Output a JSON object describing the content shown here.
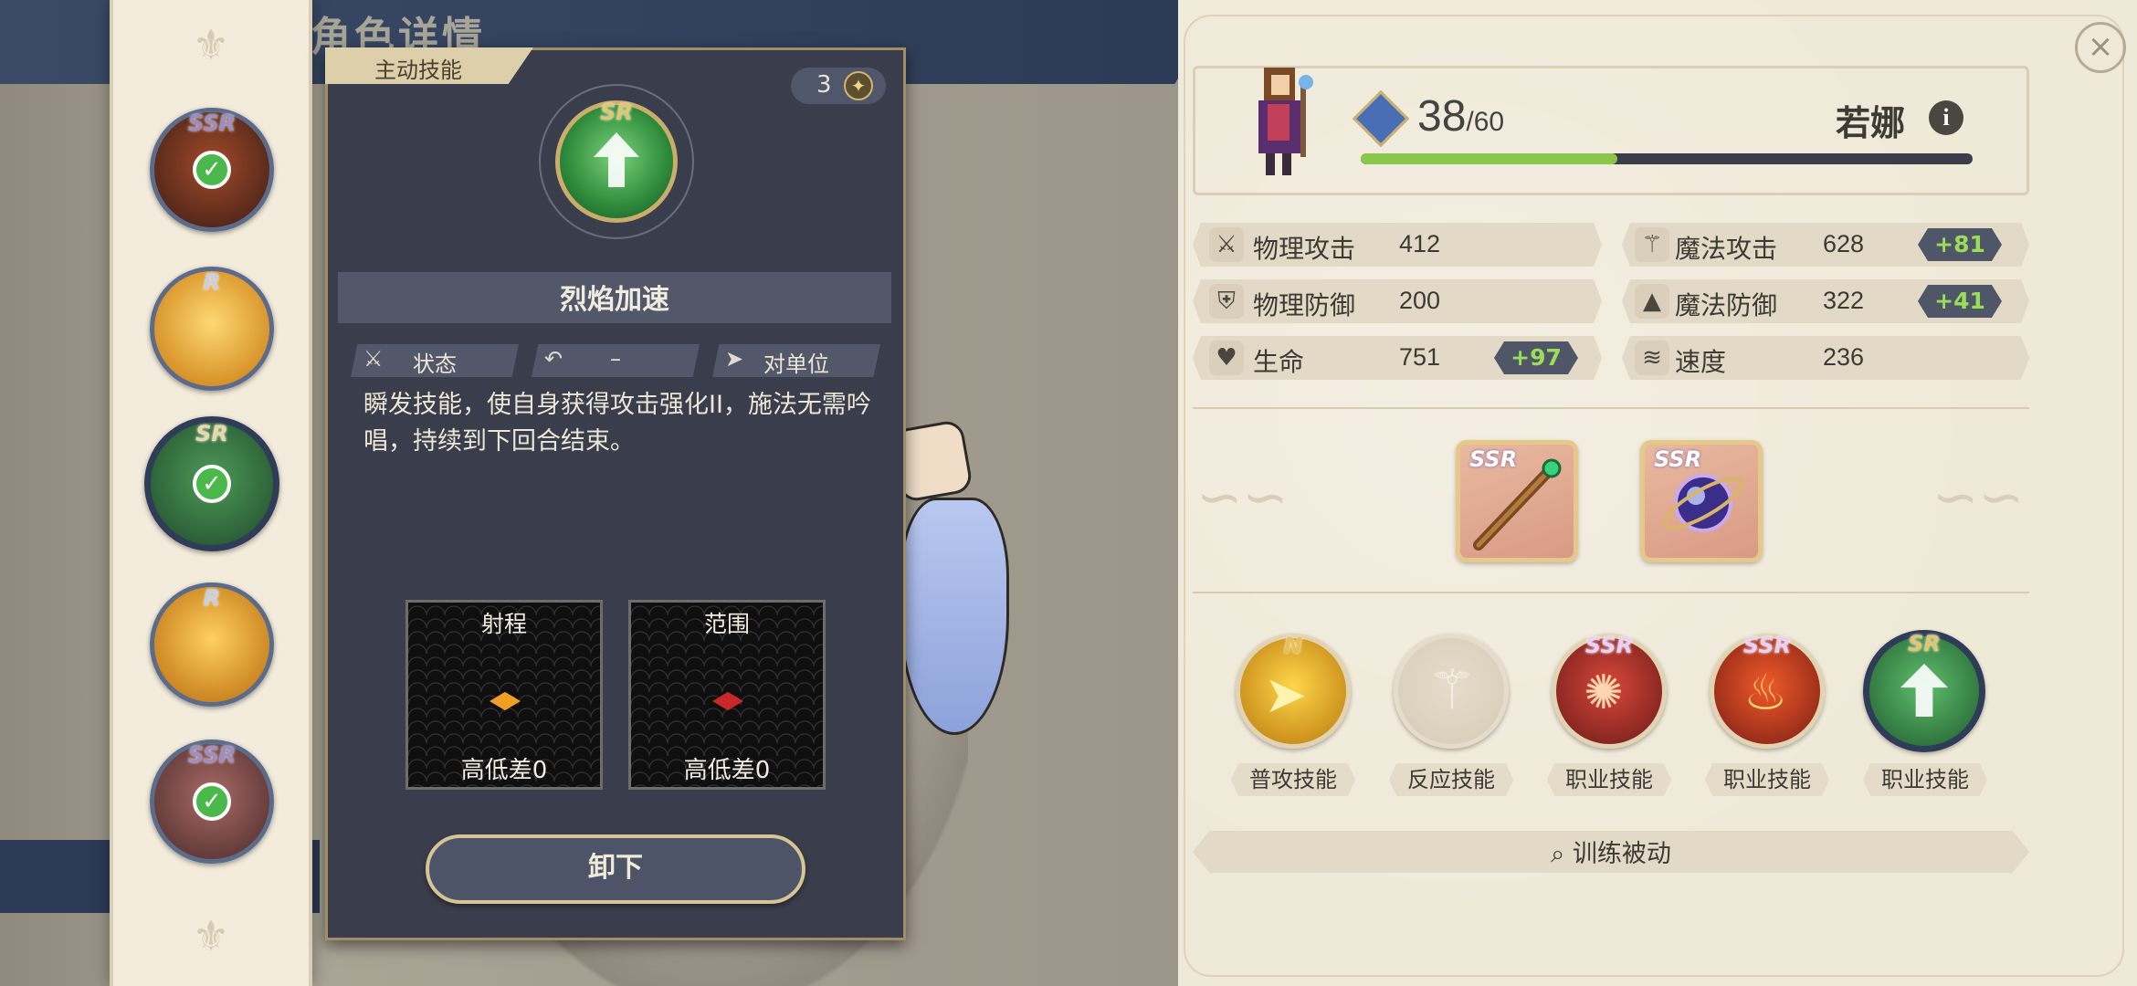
{
  "background": {
    "title": "角色详情"
  },
  "sidebar": {
    "skills": [
      {
        "rarity": "SSR",
        "equipped": true,
        "colors": [
          "#a24a2a",
          "#3a1c14"
        ]
      },
      {
        "rarity": "R",
        "equipped": false,
        "colors": [
          "#ffd873",
          "#c7780c"
        ]
      },
      {
        "rarity": "SR",
        "equipped": true,
        "selected": true,
        "colors": [
          "#4e9a58",
          "#1f4a2a"
        ]
      },
      {
        "rarity": "R",
        "equipped": false,
        "colors": [
          "#ffd060",
          "#b86a0a"
        ]
      },
      {
        "rarity": "SSR",
        "equipped": true,
        "colors": [
          "#a86a66",
          "#4a2a2a"
        ]
      }
    ]
  },
  "panel": {
    "tab_label": "主动技能",
    "count": "3",
    "skill_rarity": "SR",
    "skill_name": "烈焰加速",
    "tags": [
      {
        "icon": "sword-icon",
        "glyph": "⚔",
        "label": "状态"
      },
      {
        "icon": "curve-icon",
        "glyph": "↶",
        "label": "–"
      },
      {
        "icon": "target-icon",
        "glyph": "➤",
        "label": "对单位"
      }
    ],
    "description": "瞬发技能，使自身获得攻击强化II，施法无需吟唱，持续到下回合结束。",
    "range_title": "射程",
    "range_height": "高低差0",
    "area_title": "范围",
    "area_height": "高低差0",
    "range_color": "#f0a020",
    "area_color": "#c8282a",
    "unequip_label": "卸下"
  },
  "character": {
    "level": "38",
    "level_max": "/60",
    "name": "若娜",
    "xp_progress": 0.42
  },
  "stats": [
    {
      "icon": "sword-icon",
      "glyph": "⚔",
      "label": "物理攻击",
      "value": "412",
      "bonus": ""
    },
    {
      "icon": "staff-icon",
      "glyph": "⚚",
      "label": "魔法攻击",
      "value": "628",
      "bonus": "+81"
    },
    {
      "icon": "shield-icon",
      "glyph": "⛨",
      "label": "物理防御",
      "value": "200",
      "bonus": ""
    },
    {
      "icon": "hat-icon",
      "glyph": "▲",
      "label": "魔法防御",
      "value": "322",
      "bonus": "+41"
    },
    {
      "icon": "heart-icon",
      "glyph": "♥",
      "label": "生命",
      "value": "751",
      "bonus": "+97"
    },
    {
      "icon": "wing-icon",
      "glyph": "≋",
      "label": "速度",
      "value": "236",
      "bonus": ""
    }
  ],
  "equipment": [
    {
      "rarity": "SSR",
      "name": "staff"
    },
    {
      "rarity": "SSR",
      "name": "orb"
    }
  ],
  "skills": [
    {
      "rarity": "N",
      "label": "普攻技能",
      "colors": [
        "#ffd64a",
        "#b8780c"
      ]
    },
    {
      "rarity": "",
      "label": "反应技能",
      "colors": [
        "#e6dccb",
        "#d6cbb6"
      ],
      "empty": true
    },
    {
      "rarity": "SSR",
      "label": "职业技能",
      "colors": [
        "#d8473a",
        "#6a1a18"
      ]
    },
    {
      "rarity": "SSR",
      "label": "职业技能",
      "colors": [
        "#f05a2a",
        "#7a1c14"
      ]
    },
    {
      "rarity": "SR",
      "label": "职业技能",
      "colors": [
        "#5fbf6c",
        "#1f5a2e"
      ],
      "selected": true
    }
  ],
  "train_label": "训练被动",
  "colors": {
    "accent": "#89c64a",
    "panel": "#3a3e4c",
    "parchment": "#efe9d8"
  }
}
